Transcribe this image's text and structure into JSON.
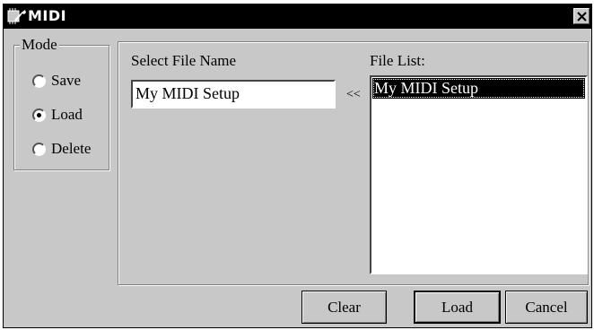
{
  "window": {
    "title": "MIDI"
  },
  "mode": {
    "legend": "Mode",
    "options": [
      {
        "label": "Save",
        "selected": false
      },
      {
        "label": "Load",
        "selected": true
      },
      {
        "label": "Delete",
        "selected": false
      }
    ]
  },
  "file": {
    "select_label": "Select File Name",
    "name_value": "My MIDI Setup",
    "copy_arrow": "<<",
    "list_label": "File List:",
    "list_items": [
      "My MIDI Setup"
    ]
  },
  "buttons": {
    "clear": "Clear",
    "load": "Load",
    "cancel": "Cancel"
  },
  "icons": {
    "app": "wrench-chip-icon",
    "close": "close-icon"
  }
}
